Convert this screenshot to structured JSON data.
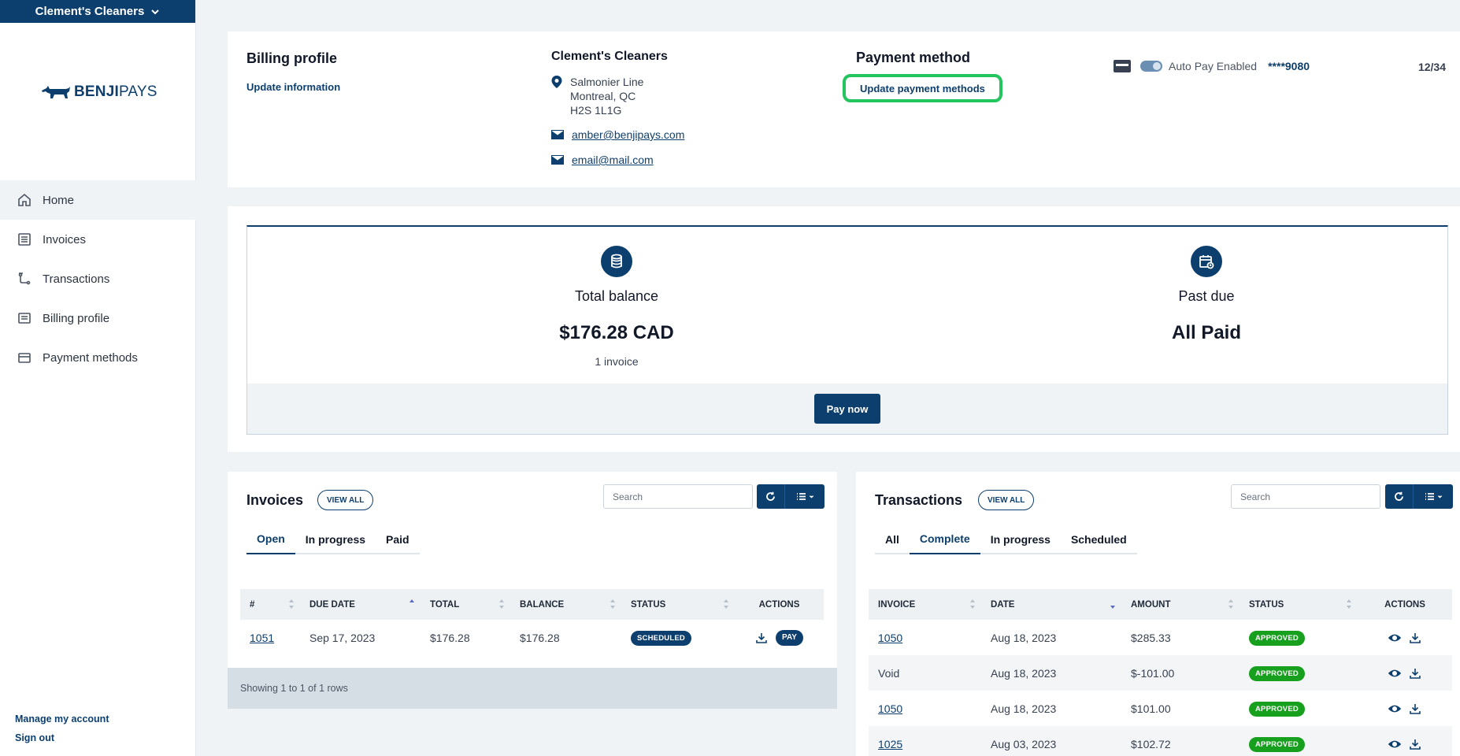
{
  "sidebar": {
    "org_name": "Clement's Cleaners",
    "logo_text_bold": "BENJI",
    "logo_text_light": "PAYS",
    "nav": [
      {
        "label": "Home",
        "icon": "home-icon",
        "active": true
      },
      {
        "label": "Invoices",
        "icon": "invoice-icon"
      },
      {
        "label": "Transactions",
        "icon": "transactions-icon"
      },
      {
        "label": "Billing profile",
        "icon": "billing-profile-icon"
      },
      {
        "label": "Payment methods",
        "icon": "credit-card-icon"
      }
    ],
    "manage_account": "Manage my account",
    "sign_out": "Sign out"
  },
  "billing": {
    "title": "Billing profile",
    "update_link": "Update information",
    "company": "Clement's Cleaners",
    "address_line1": "Salmonier Line",
    "address_line2": "Montreal, QC",
    "address_line3": "H2S 1L1G",
    "email1": "amber@benjipays.com",
    "email2": "email@mail.com"
  },
  "payment": {
    "title": "Payment method",
    "update_button": "Update payment methods",
    "autopay_label": "Auto Pay Enabled",
    "autopay_enabled": true,
    "card_last4": "****9080",
    "expiry": "12/34"
  },
  "summary": {
    "total_label": "Total balance",
    "total_value": "$176.28 CAD",
    "total_sub": "1 invoice",
    "past_due_label": "Past due",
    "past_due_value": "All Paid",
    "pay_now": "Pay now"
  },
  "invoices": {
    "title": "Invoices",
    "view_all": "VIEW ALL",
    "search_placeholder": "Search",
    "tabs": [
      "Open",
      "In progress",
      "Paid"
    ],
    "active_tab": "Open",
    "columns": [
      "#",
      "DUE DATE",
      "TOTAL",
      "BALANCE",
      "STATUS",
      "ACTIONS"
    ],
    "rows": [
      {
        "num": "1051",
        "due": "Sep 17, 2023",
        "total": "$176.28",
        "balance": "$176.28",
        "status": "SCHEDULED",
        "action": "PAY"
      }
    ],
    "footer": "Showing 1 to 1 of 1 rows"
  },
  "transactions": {
    "title": "Transactions",
    "view_all": "VIEW ALL",
    "search_placeholder": "Search",
    "tabs": [
      "All",
      "Complete",
      "In progress",
      "Scheduled"
    ],
    "active_tab": "Complete",
    "columns": [
      "INVOICE",
      "DATE",
      "AMOUNT",
      "STATUS",
      "ACTIONS"
    ],
    "rows": [
      {
        "invoice": "1050",
        "link": true,
        "date": "Aug 18, 2023",
        "amount": "$285.33",
        "status": "APPROVED"
      },
      {
        "invoice": "Void",
        "link": false,
        "date": "Aug 18, 2023",
        "amount": "$-101.00",
        "status": "APPROVED"
      },
      {
        "invoice": "1050",
        "link": true,
        "date": "Aug 18, 2023",
        "amount": "$101.00",
        "status": "APPROVED"
      },
      {
        "invoice": "1025",
        "link": true,
        "date": "Aug 03, 2023",
        "amount": "$102.72",
        "status": "APPROVED"
      }
    ]
  },
  "colors": {
    "brand": "#0d3f6e",
    "approved": "#16a01e",
    "highlight": "#22c55e"
  }
}
